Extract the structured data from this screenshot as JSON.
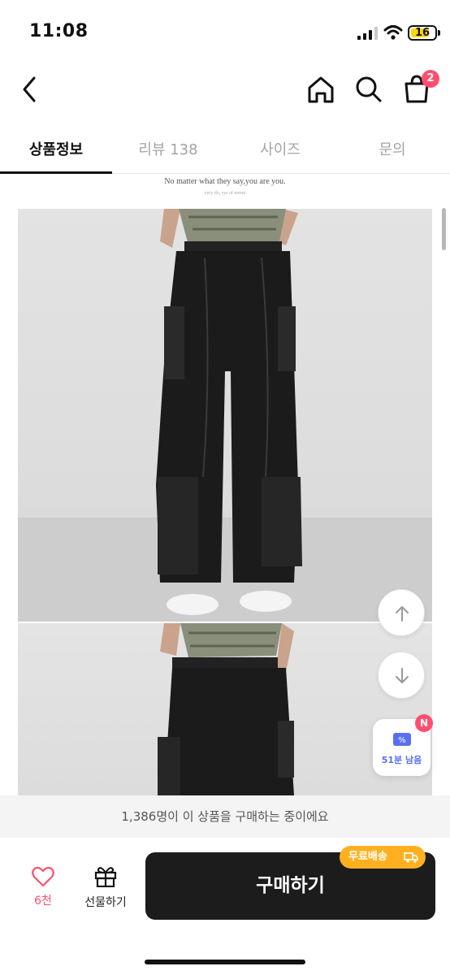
{
  "status_bar": {
    "time": "11:08",
    "battery": "16"
  },
  "header": {
    "cart_count": "2"
  },
  "tabs": [
    {
      "label": "상품정보"
    },
    {
      "label": "리뷰 138"
    },
    {
      "label": "사이즈"
    },
    {
      "label": "문의"
    }
  ],
  "content": {
    "caption": "No matter what they say,you are you.",
    "caption_small": "very do, sys of mmm"
  },
  "coupon": {
    "label": "51분 남음",
    "badge": "N"
  },
  "buyers_notice": "1,386명이 이 상품을 구매하는 중이에요",
  "bottom_bar": {
    "like_count": "6천",
    "gift_label": "선물하기",
    "buy_label": "구매하기",
    "shipping_badge": "무료배송"
  },
  "colors": {
    "accent": "#ff4f6e",
    "buy_button": "#1c1c1c",
    "shipping": "#ffb020",
    "coupon": "#5a6ff0"
  },
  "icons": [
    "back-icon",
    "home-icon",
    "search-icon",
    "cart-icon",
    "arrow-up-icon",
    "arrow-down-icon",
    "coupon-icon",
    "heart-icon",
    "gift-icon",
    "truck-icon"
  ]
}
